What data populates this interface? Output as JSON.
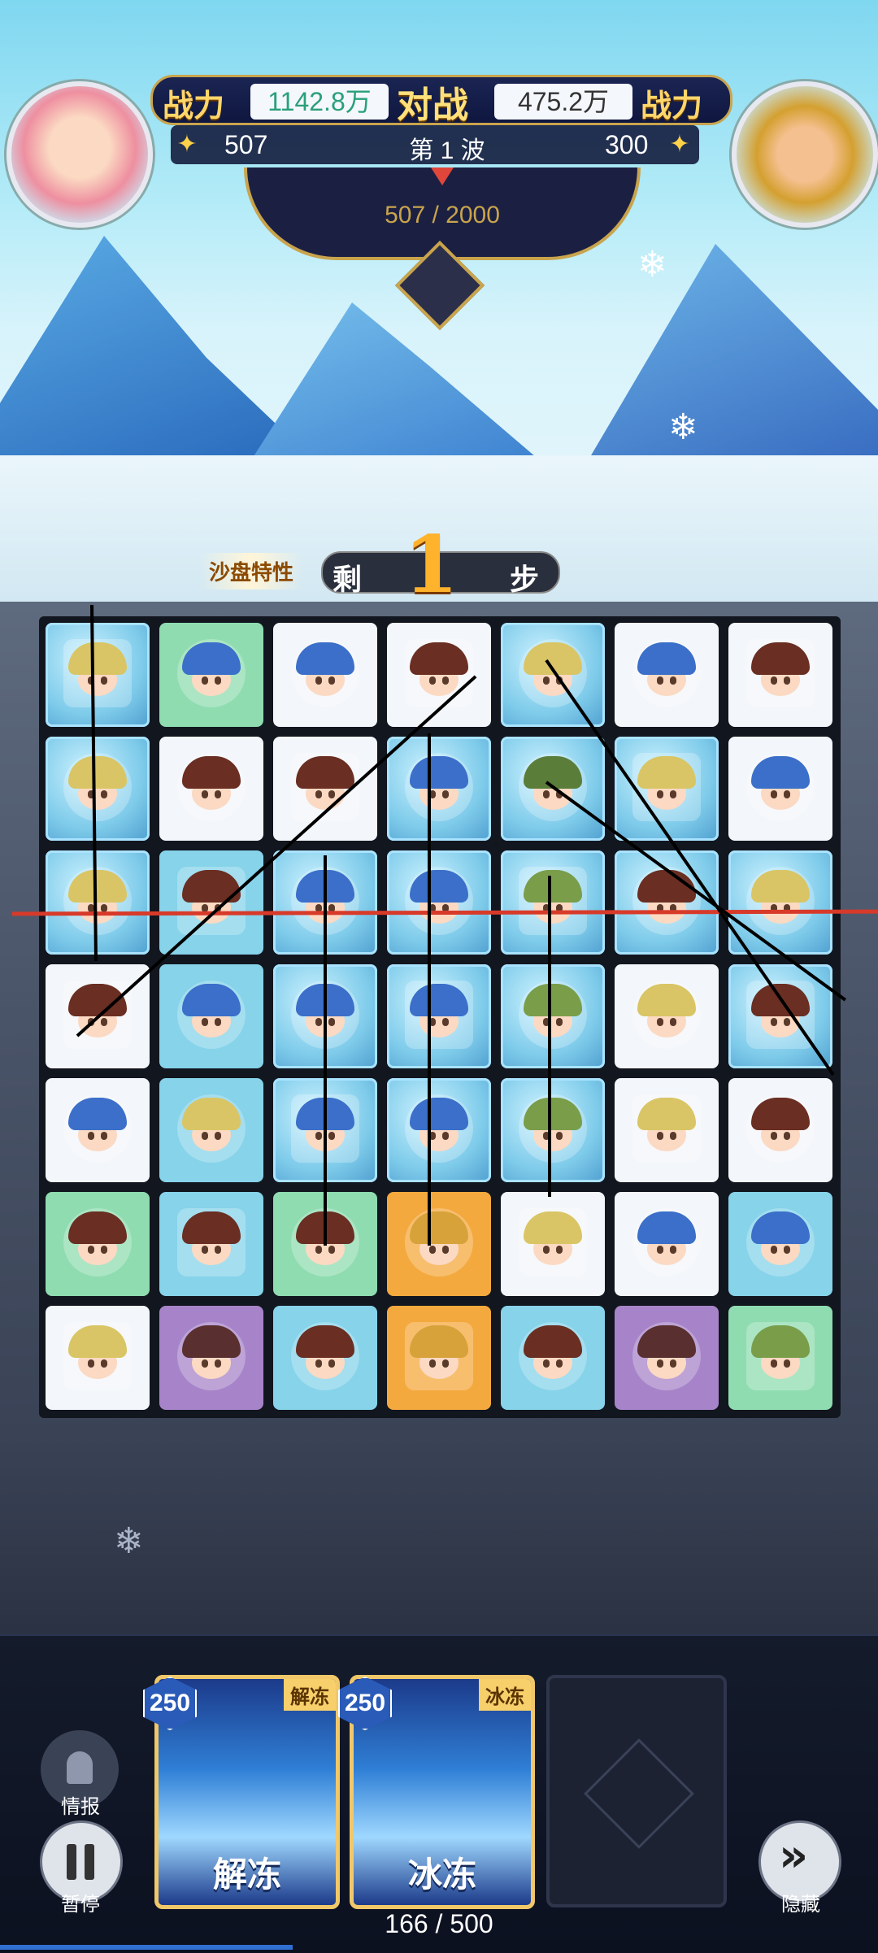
{
  "hud": {
    "left_power_label": "战力",
    "left_power_value": "1142.8万",
    "vs_label": "对战",
    "right_power_value": "475.2万",
    "right_power_label": "战力",
    "left_score": "507",
    "wave_label": "第 1 波",
    "right_score": "300",
    "progress_text": "507 / 2000"
  },
  "banner": {
    "trait_label": "沙盘特性",
    "remaining_prefix": "剩",
    "steps_left": "1",
    "steps_suffix": "步"
  },
  "skills": [
    {
      "cost": "250",
      "tag": "解冻",
      "name": "解冻"
    },
    {
      "cost": "250",
      "tag": "冰冻",
      "name": "冰冻"
    }
  ],
  "buttons": {
    "intel_label": "情报",
    "pause_label": "暂停",
    "hide_label": "隐藏"
  },
  "footer": {
    "energy_text": "166 / 500"
  },
  "board": {
    "rows": 7,
    "cols": 7,
    "tiles": [
      [
        "ice",
        "green",
        "plain",
        "plain",
        "ice",
        "plain",
        "plain"
      ],
      [
        "ice",
        "plain",
        "plain",
        "ice",
        "ice",
        "ice",
        "plain"
      ],
      [
        "ice",
        "cyan",
        "ice",
        "ice",
        "ice",
        "ice",
        "ice"
      ],
      [
        "plain",
        "cyan",
        "ice",
        "ice",
        "ice",
        "plain",
        "ice"
      ],
      [
        "plain",
        "cyan",
        "ice",
        "ice",
        "ice",
        "plain",
        "plain"
      ],
      [
        "green",
        "cyan",
        "green",
        "orange",
        "plain",
        "plain",
        "cyan"
      ],
      [
        "plain",
        "purple",
        "cyan",
        "orange",
        "cyan",
        "purple",
        "green"
      ]
    ],
    "heroes": [
      [
        "blonde",
        "blue",
        "blue",
        "brown",
        "blonde",
        "blue",
        "brown"
      ],
      [
        "blonde",
        "brown",
        "brown",
        "blue",
        "green",
        "blonde",
        "blue"
      ],
      [
        "blonde",
        "brown",
        "blue",
        "blue",
        "red",
        "brown",
        "blonde"
      ],
      [
        "brown",
        "blue",
        "blue",
        "blue",
        "red",
        "blonde",
        "brown"
      ],
      [
        "blue",
        "blonde",
        "blue",
        "blue",
        "red",
        "blonde",
        "brown"
      ],
      [
        "brown",
        "brown",
        "brown",
        "gold",
        "blonde",
        "blue",
        "blue"
      ],
      [
        "blonde",
        "teal",
        "brown",
        "gold",
        "brown",
        "teal",
        "red"
      ]
    ]
  },
  "colors": {
    "gold": "#c9a44d",
    "power_green": "#2aa07a",
    "marker_red": "#d83a2a"
  }
}
